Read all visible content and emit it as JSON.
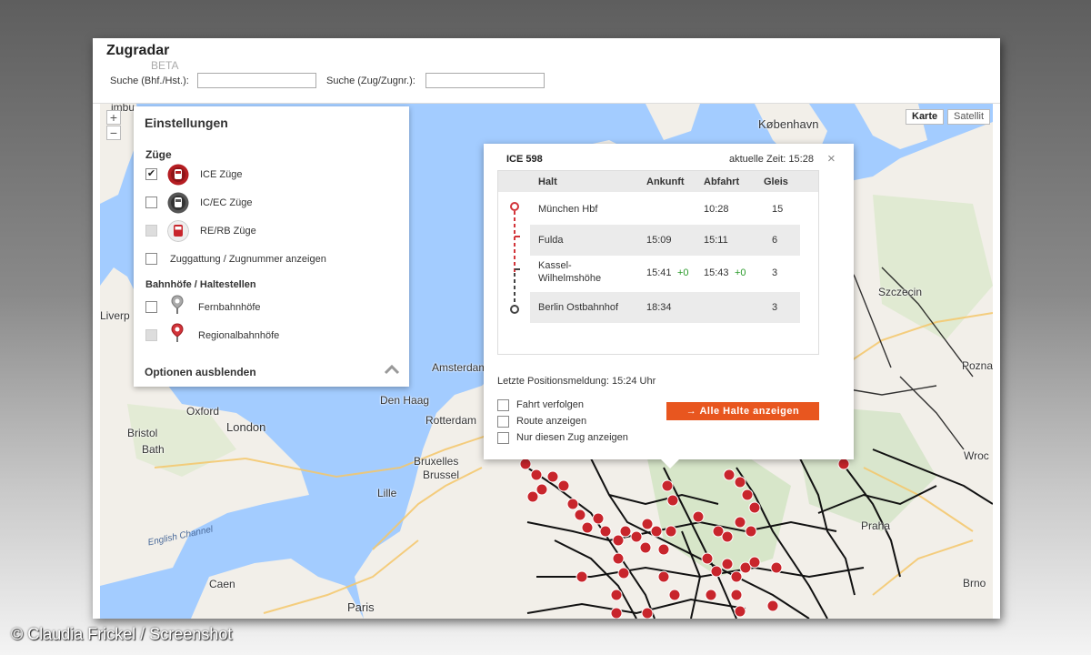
{
  "header": {
    "title": "Zugradar",
    "beta": "BETA",
    "search_station_label": "Suche (Bhf./Hst.):",
    "search_station_value": "",
    "search_train_label": "Suche (Zug/Zugnr.):",
    "search_train_value": ""
  },
  "map": {
    "zoom_in": "+",
    "zoom_out": "−",
    "map_types": [
      "Karte",
      "Satellit"
    ],
    "active_map_type": "Karte",
    "cities": {
      "limb": "imbu",
      "kobenhavn": "København",
      "szczecin": "Szczecin",
      "liverp": "Liverp",
      "amsterdam": "Amsterdam",
      "den_haag": "Den Haag",
      "rotterdam": "Rotterdam",
      "oxford": "Oxford",
      "london": "London",
      "bristol": "Bristol",
      "bath": "Bath",
      "bruxelles": "Bruxelles",
      "brussel": "Brussel",
      "lille": "Lille",
      "poznan": "Pozna",
      "wroc": "Wroc",
      "caen": "Caen",
      "paris": "Paris",
      "praha": "Praha",
      "brno": "Brno"
    },
    "english_channel": "English Channel",
    "colors": {
      "water": "#a3ccff",
      "land": "#f2efe9",
      "rail": "#111111",
      "station": "#c8252c"
    }
  },
  "settings": {
    "title": "Einstellungen",
    "trains_section": "Züge",
    "ice": {
      "label": "ICE Züge",
      "checked": "✔"
    },
    "icec": {
      "label": "IC/EC Züge"
    },
    "rerb": {
      "label": "RE/RB Züge"
    },
    "zuggattung": {
      "label": "Zuggattung / Zugnummer anzeigen"
    },
    "stations_section": "Bahnhöfe / Haltestellen",
    "fern": {
      "label": "Fernbahnhöfe"
    },
    "regional": {
      "label": "Regionalbahnhöfe"
    },
    "hide_options": "Optionen ausblenden"
  },
  "popup": {
    "train": "ICE 598",
    "current_time": "aktuelle Zeit: 15:28",
    "close": "×",
    "columns": {
      "halt": "Halt",
      "ankunft": "Ankunft",
      "abfahrt": "Abfahrt",
      "gleis": "Gleis"
    },
    "stops": [
      {
        "halt": "München Hbf",
        "ankunft": "",
        "ankunft_delay": "",
        "abfahrt": "10:28",
        "abfahrt_delay": "",
        "gleis": "15"
      },
      {
        "halt": "Fulda",
        "ankunft": "15:09",
        "ankunft_delay": "",
        "abfahrt": "15:11",
        "abfahrt_delay": "",
        "gleis": "6"
      },
      {
        "halt": "Kassel-",
        "halt2": "Wilhelmshöhe",
        "ankunft": "15:41",
        "ankunft_delay": "+0",
        "abfahrt": "15:43",
        "abfahrt_delay": "+0",
        "gleis": "3"
      },
      {
        "halt": "Berlin Ostbahnhof",
        "ankunft": "18:34",
        "ankunft_delay": "",
        "abfahrt": "",
        "abfahrt_delay": "",
        "gleis": "3"
      }
    ],
    "last_position": "Letzte Positionsmeldung: 15:24 Uhr",
    "options": [
      "Fahrt verfolgen",
      "Route anzeigen",
      "Nur diesen Zug anzeigen"
    ],
    "all_stops_button": "Alle Halte anzeigen",
    "arrow": "→"
  },
  "copyright": "© Claudia Frickel / Screenshot"
}
